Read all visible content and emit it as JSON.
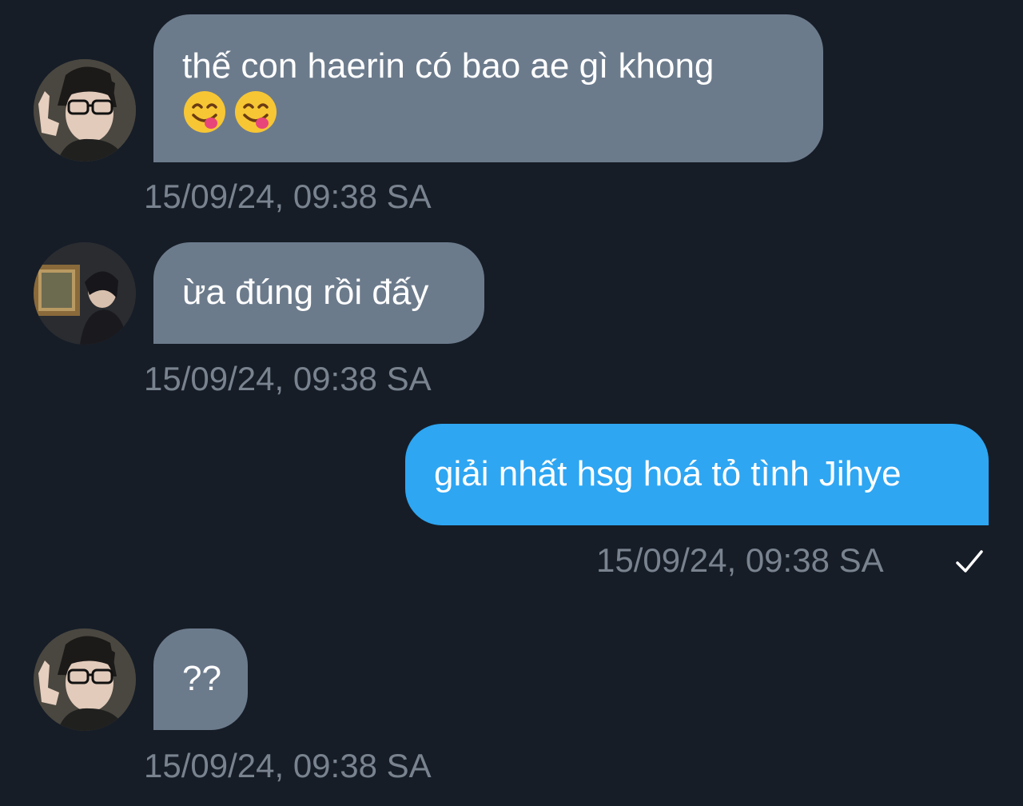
{
  "messages": [
    {
      "direction": "incoming",
      "avatar": "avatar-boy-glasses",
      "text": "thế con haerin có bao ae gì khong",
      "emojis": [
        "face-savoring-food-icon",
        "face-savoring-food-icon"
      ],
      "timestamp": "15/09/24, 09:38 SA"
    },
    {
      "direction": "incoming",
      "avatar": "avatar-boy-painting",
      "text": "ừa đúng rồi đấy",
      "timestamp": "15/09/24, 09:38 SA"
    },
    {
      "direction": "outgoing",
      "text": "giải nhất hsg hoá tỏ tình Jihye",
      "timestamp": "15/09/24, 09:38 SA",
      "status": "sent-check-icon"
    },
    {
      "direction": "incoming",
      "avatar": "avatar-boy-glasses",
      "text": "??",
      "timestamp": "15/09/24, 09:38 SA"
    }
  ],
  "colors": {
    "background": "#161d27",
    "incoming_bubble": "#6c7b8c",
    "outgoing_bubble": "#2ea6f2",
    "timestamp": "#79838f",
    "text": "#ffffff"
  }
}
